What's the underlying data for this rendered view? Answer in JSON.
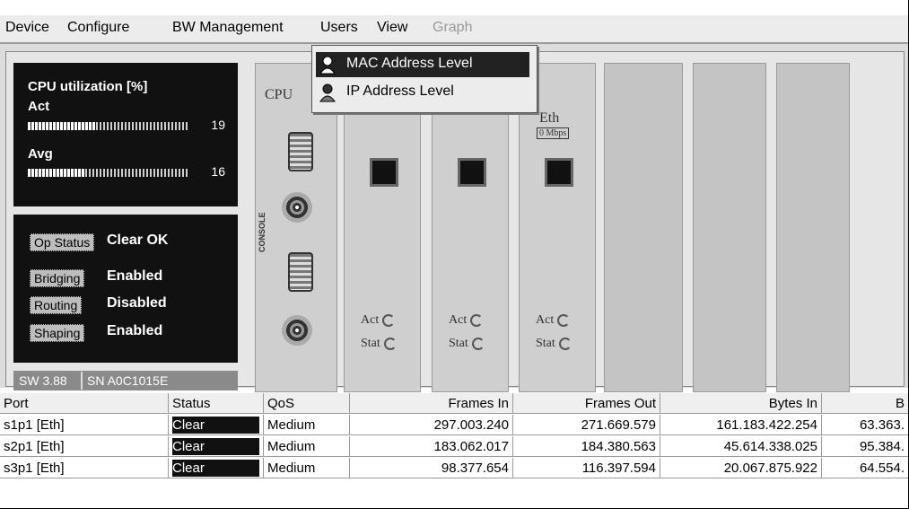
{
  "menu": {
    "items": [
      "Device",
      "Configure",
      "BW Management",
      "Users",
      "View",
      "Graph"
    ]
  },
  "dropdown": {
    "items": [
      "MAC Address Level",
      "IP Address Level"
    ]
  },
  "cpu": {
    "title": "CPU utilization [%]",
    "act_label": "Act",
    "act_value": "19",
    "avg_label": "Avg",
    "avg_value": "16",
    "act_level": 0.19,
    "avg_level": 0.16
  },
  "status": {
    "rows": [
      {
        "label": "Op Status",
        "value": "Clear OK"
      },
      {
        "label": "Bridging",
        "value": "Enabled"
      },
      {
        "label": "Routing",
        "value": "Disabled"
      },
      {
        "label": "Shaping",
        "value": "Enabled"
      }
    ],
    "sw": "SW 3.88",
    "sn": "SN A0C1015E"
  },
  "slots": {
    "cpu_label": "CPU",
    "console_label": "CONSOLE",
    "eth_label": "Eth",
    "speed_label": "0 Mbps",
    "act": "Act",
    "stat": "Stat"
  },
  "table": {
    "headers": [
      "Port",
      "Status",
      "QoS",
      "Frames In",
      "Frames Out",
      "Bytes In",
      "B"
    ],
    "rows": [
      [
        "s1p1  [Eth]",
        "Clear",
        "Medium",
        "297.003.240",
        "271.669.579",
        "161.183.422.254",
        "63.363."
      ],
      [
        "s2p1  [Eth]",
        "Clear",
        "Medium",
        "183.062.017",
        "184.380.563",
        "45.614.338.025",
        "95.384."
      ],
      [
        "s3p1  [Eth]",
        "Clear",
        "Medium",
        "98.377.654",
        "116.397.594",
        "20.067.875.922",
        "64.554."
      ]
    ]
  }
}
